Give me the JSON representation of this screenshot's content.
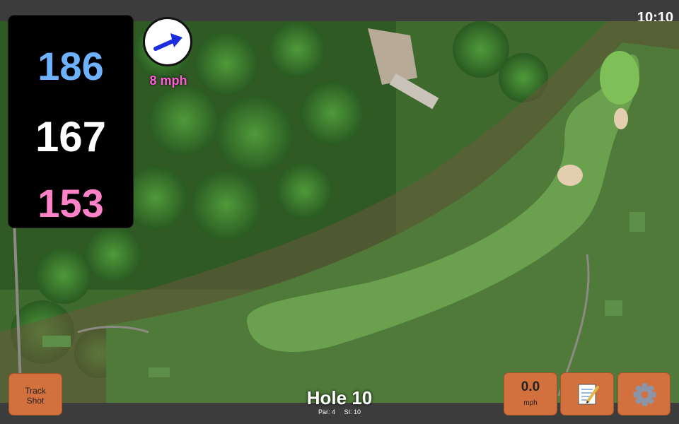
{
  "status": {
    "time": "10:10"
  },
  "distances": {
    "back": "186",
    "middle": "167",
    "front": "153"
  },
  "wind": {
    "speed_label": "8 mph",
    "button_value": "0.0",
    "button_unit": "mph"
  },
  "buttons": {
    "track_shot_line1": "Track",
    "track_shot_line2": "Shot"
  },
  "hole": {
    "title": "Hole 10",
    "par": "Par: 4",
    "si": "SI: 10"
  },
  "icons": {
    "wind_arrow": "wind-direction-arrow-icon",
    "notes": "notepad-icon",
    "settings": "gear-icon"
  },
  "colors": {
    "back": "#6eb2ff",
    "middle": "#ffffff",
    "front": "#ff82c8",
    "wind_speed": "#ff5bd6",
    "button": "#d2703e"
  }
}
